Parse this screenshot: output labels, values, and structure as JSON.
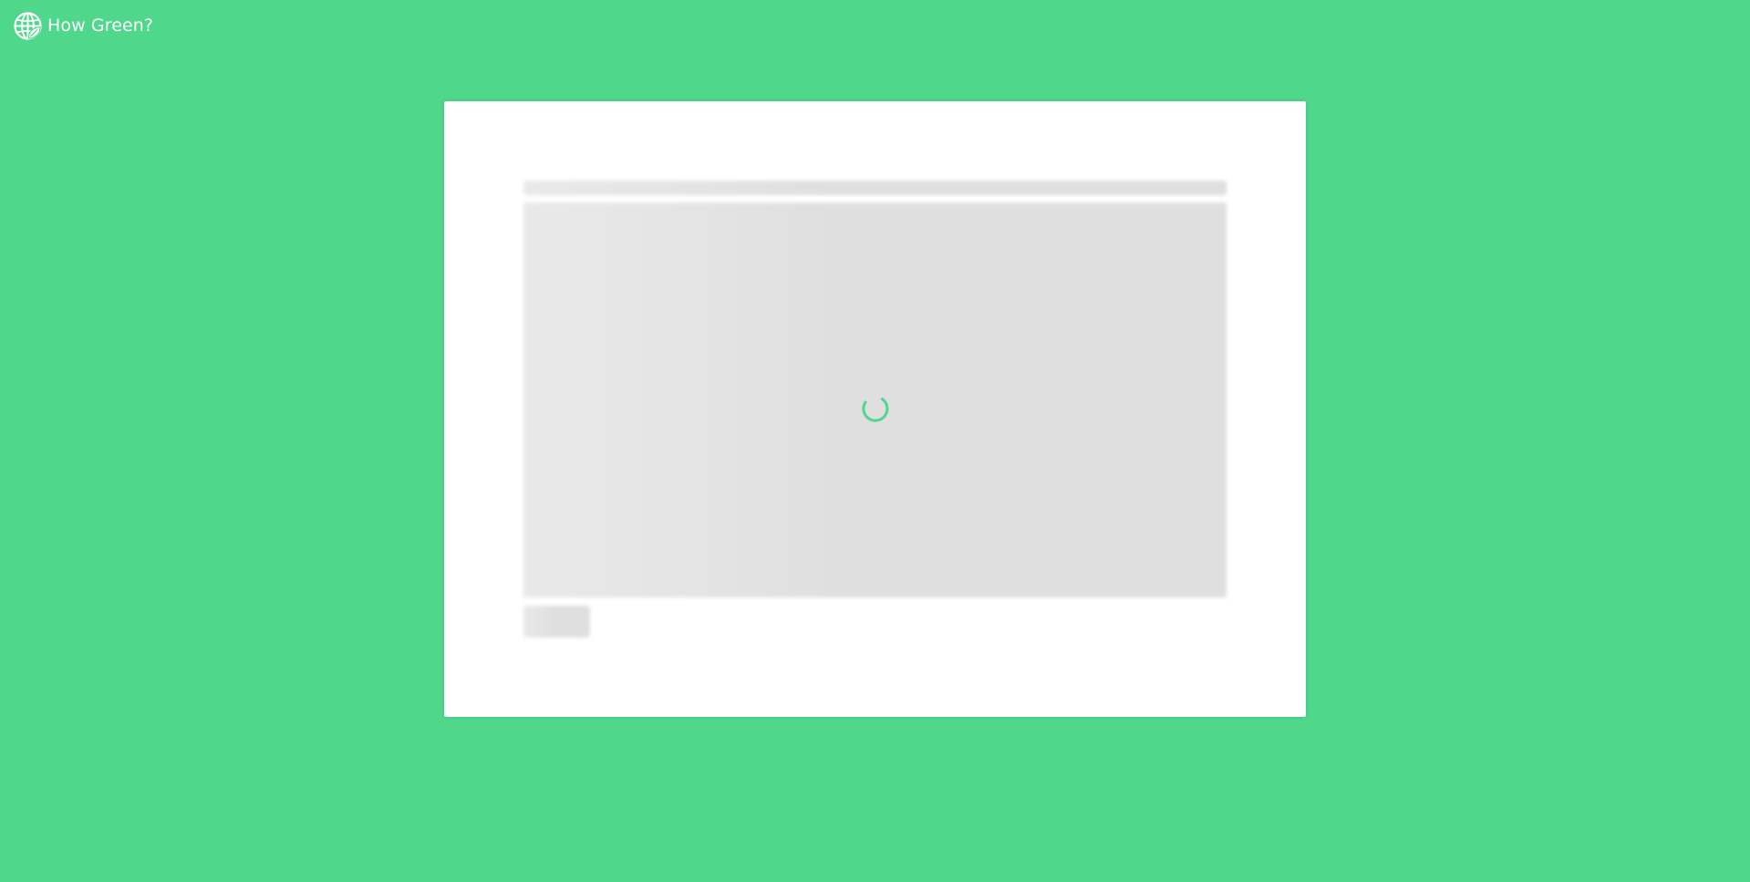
{
  "app": {
    "brand_name": "How Green?",
    "brand_icon": "globe-leaf-icon",
    "background_color": "#4fd78c",
    "accent_color": "#4fd78c"
  },
  "loading": {
    "spinner_icon": "loading-spinner-icon"
  }
}
